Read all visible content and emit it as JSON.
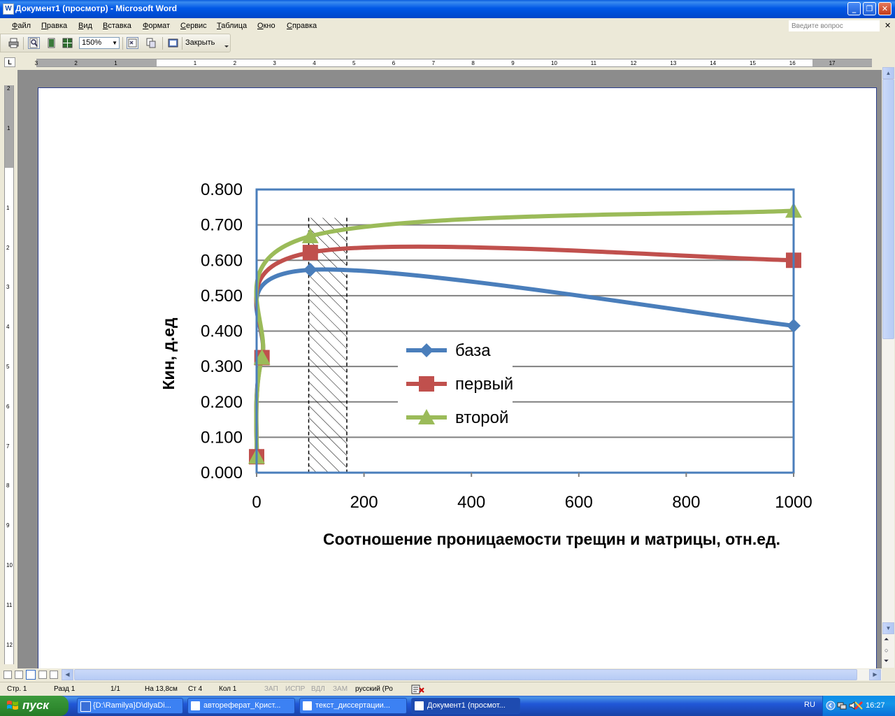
{
  "window": {
    "title": "Документ1 (просмотр) - Microsoft Word",
    "app_icon": "W",
    "min": "_",
    "max": "❐",
    "close": "✕"
  },
  "menu": {
    "items": [
      "Файл",
      "Правка",
      "Вид",
      "Вставка",
      "Формат",
      "Сервис",
      "Таблица",
      "Окно",
      "Справка"
    ],
    "ask_placeholder": "Введите вопрос",
    "close_doc": "✕"
  },
  "toolbar": {
    "zoom": "150%",
    "close_label": "Закрыть"
  },
  "ruler": {
    "corner": "L",
    "h_left": [
      "3",
      "2",
      "1"
    ],
    "h_right": [
      "1",
      "2",
      "3",
      "4",
      "5",
      "6",
      "7",
      "8",
      "9",
      "10",
      "11",
      "12",
      "13",
      "14",
      "15",
      "16",
      "17"
    ],
    "v_top": [
      "2",
      "1"
    ],
    "v_main": [
      "1",
      "2",
      "3",
      "4",
      "5",
      "6",
      "7",
      "8",
      "9",
      "10",
      "11",
      "12"
    ]
  },
  "chart_data": {
    "type": "line",
    "xlabel": "Соотношение проницаемости трещин и матрицы, отн.ед.",
    "ylabel": "Кин, д.ед",
    "xlim": [
      0,
      1000
    ],
    "ylim": [
      0,
      0.8
    ],
    "xticks": [
      "0",
      "200",
      "400",
      "600",
      "800",
      "1000"
    ],
    "yticks": [
      "0.000",
      "0.100",
      "0.200",
      "0.300",
      "0.400",
      "0.500",
      "0.600",
      "0.700",
      "0.800"
    ],
    "grid": "horizontal",
    "legend_position": "center-right",
    "shaded_band": [
      97,
      168
    ],
    "series": [
      {
        "name": "база",
        "color": "#4a7ebb",
        "marker": "diamond",
        "points": [
          [
            0,
            0.045
          ],
          [
            10,
            0.325
          ],
          [
            100,
            0.573
          ],
          [
            1000,
            0.415
          ]
        ]
      },
      {
        "name": "первый",
        "color": "#c0504d",
        "marker": "square",
        "points": [
          [
            0,
            0.045
          ],
          [
            10,
            0.325
          ],
          [
            100,
            0.622
          ],
          [
            1000,
            0.6
          ]
        ]
      },
      {
        "name": "второй",
        "color": "#9bbb59",
        "marker": "triangle",
        "points": [
          [
            0,
            0.045
          ],
          [
            10,
            0.325
          ],
          [
            100,
            0.668
          ],
          [
            1000,
            0.74
          ]
        ]
      }
    ]
  },
  "status": {
    "page": "Стр. 1",
    "section": "Разд 1",
    "pages": "1/1",
    "at": "На 13,8см",
    "line": "Ст 4",
    "col": "Кол 1",
    "rec": "ЗАП",
    "trk": "ИСПР",
    "ext": "ВДЛ",
    "ovr": "ЗАМ",
    "lang": "русский (Ро"
  },
  "taskbar": {
    "start": "пуск",
    "tasks": [
      "{D:\\Ramilya}D\\dlyaDi...",
      "автореферат_Крист...",
      "текст_диссертации...",
      "Документ1 (просмот..."
    ],
    "lang": "RU",
    "clock": "16:27"
  },
  "colors": {
    "title_blue": "#0058e6",
    "workspace": "#8c8c8c",
    "taskbar": "#2157d7",
    "start_green": "#2f8a2f"
  }
}
